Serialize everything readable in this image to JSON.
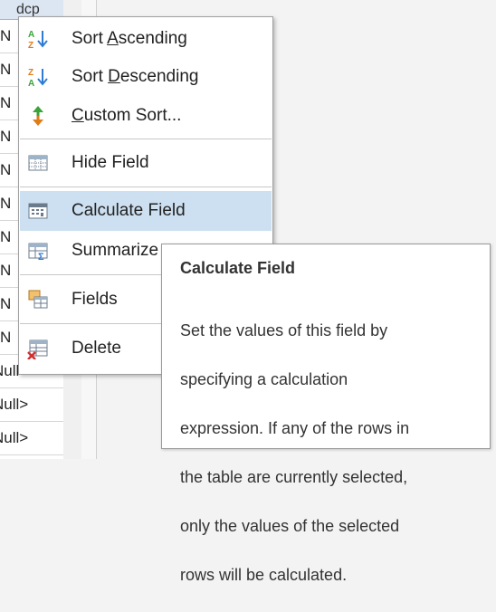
{
  "table": {
    "header_text": "dcp",
    "cells": [
      "N",
      "N",
      "N",
      "N",
      "N",
      "N",
      "N",
      "N",
      "N",
      "N",
      "Null>",
      "Null>",
      "Null>"
    ]
  },
  "context_menu": {
    "items": [
      {
        "label_pre": "Sort ",
        "label_u": "A",
        "label_post": "scending",
        "icon": "sort-ascending-icon"
      },
      {
        "label_pre": "Sort ",
        "label_u": "D",
        "label_post": "escending",
        "icon": "sort-descending-icon"
      },
      {
        "label_pre": "",
        "label_u": "C",
        "label_post": "ustom Sort...",
        "icon": "custom-sort-icon"
      },
      {
        "label_pre": "Hide Field",
        "label_u": "",
        "label_post": "",
        "icon": "hide-field-icon"
      },
      {
        "label_pre": "Calculate Field",
        "label_u": "",
        "label_post": "",
        "icon": "calculate-field-icon"
      },
      {
        "label_pre": "Summarize",
        "label_u": "",
        "label_post": "",
        "icon": "summarize-icon"
      },
      {
        "label_pre": "Fields",
        "label_u": "",
        "label_post": "",
        "icon": "fields-icon"
      },
      {
        "label_pre": "Delete",
        "label_u": "",
        "label_post": "",
        "icon": "delete-field-icon"
      }
    ],
    "hover_item": "Calculate Field"
  },
  "tooltip": {
    "title": "Calculate Field",
    "body_lines": [
      "Set the values of this field by",
      "specifying a calculation",
      "expression. If any of the rows in",
      "the table are currently selected,",
      "only the values of the selected",
      "rows will be calculated."
    ]
  },
  "colors": {
    "hover_bg": "#cde0f1",
    "icon_blue": "#2e7bd6",
    "icon_green": "#3aa33a",
    "icon_orange": "#e07b18",
    "icon_red": "#d32f2f"
  }
}
